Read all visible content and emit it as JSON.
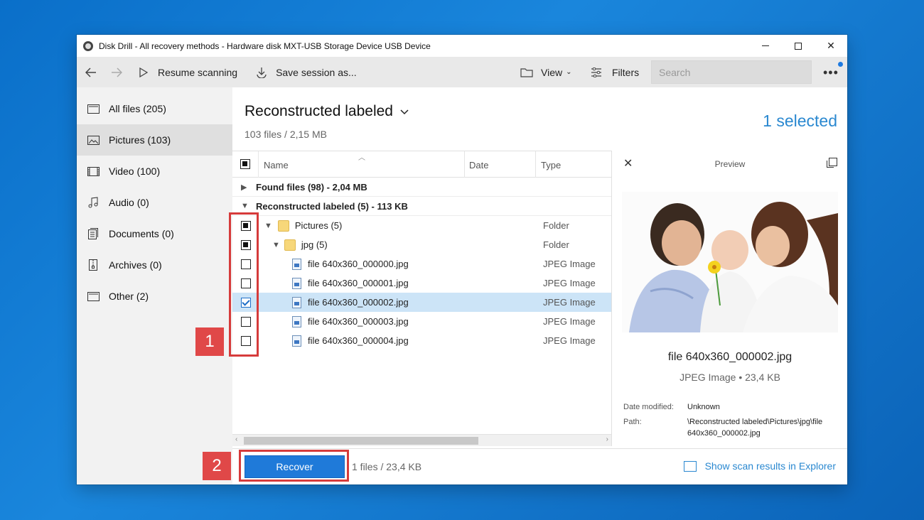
{
  "window": {
    "title": "Disk Drill - All recovery methods - Hardware disk MXT-USB Storage Device USB Device"
  },
  "toolbar": {
    "resume_label": "Resume scanning",
    "save_label": "Save session as...",
    "view_label": "View",
    "filters_label": "Filters",
    "search_placeholder": "Search"
  },
  "sidebar": {
    "items": [
      {
        "label": "All files (205)",
        "icon": "file-icon"
      },
      {
        "label": "Pictures (103)",
        "icon": "picture-icon"
      },
      {
        "label": "Video (100)",
        "icon": "film-icon"
      },
      {
        "label": "Audio (0)",
        "icon": "music-icon"
      },
      {
        "label": "Documents (0)",
        "icon": "document-icon"
      },
      {
        "label": "Archives (0)",
        "icon": "archive-icon"
      },
      {
        "label": "Other (2)",
        "icon": "file-icon"
      }
    ]
  },
  "main": {
    "title": "Reconstructed labeled",
    "subtitle": "103 files / 2,15 MB",
    "selected": "1 selected"
  },
  "table": {
    "headers": {
      "name": "Name",
      "date": "Date",
      "type": "Type"
    },
    "groups": [
      {
        "label": "Found files (98) - 2,04 MB"
      },
      {
        "label": "Reconstructed labeled (5) - 113 KB"
      }
    ],
    "rows": [
      {
        "name": "Pictures (5)",
        "type": "Folder",
        "check": "partial"
      },
      {
        "name": "jpg (5)",
        "type": "Folder",
        "check": "partial"
      },
      {
        "name": "file 640x360_000000.jpg",
        "type": "JPEG Image",
        "check": "none"
      },
      {
        "name": "file 640x360_000001.jpg",
        "type": "JPEG Image",
        "check": "none"
      },
      {
        "name": "file 640x360_000002.jpg",
        "type": "JPEG Image",
        "check": "checked"
      },
      {
        "name": "file 640x360_000003.jpg",
        "type": "JPEG Image",
        "check": "none"
      },
      {
        "name": "file 640x360_000004.jpg",
        "type": "JPEG Image",
        "check": "none"
      }
    ]
  },
  "preview": {
    "title": "Preview",
    "filename": "file 640x360_000002.jpg",
    "meta": "JPEG Image • 23,4 KB",
    "date_label": "Date modified:",
    "date_value": "Unknown",
    "path_label": "Path:",
    "path_value": "\\Reconstructed labeled\\Pictures\\jpg\\file 640x360_000002.jpg"
  },
  "bottom": {
    "recover_label": "Recover",
    "recover_info": "1 files / 23,4 KB",
    "explorer_label": "Show scan results in Explorer"
  },
  "callouts": {
    "one": "1",
    "two": "2"
  },
  "colors": {
    "accent": "#1f7ad9",
    "callout": "#e04848",
    "link": "#2a88d0"
  }
}
